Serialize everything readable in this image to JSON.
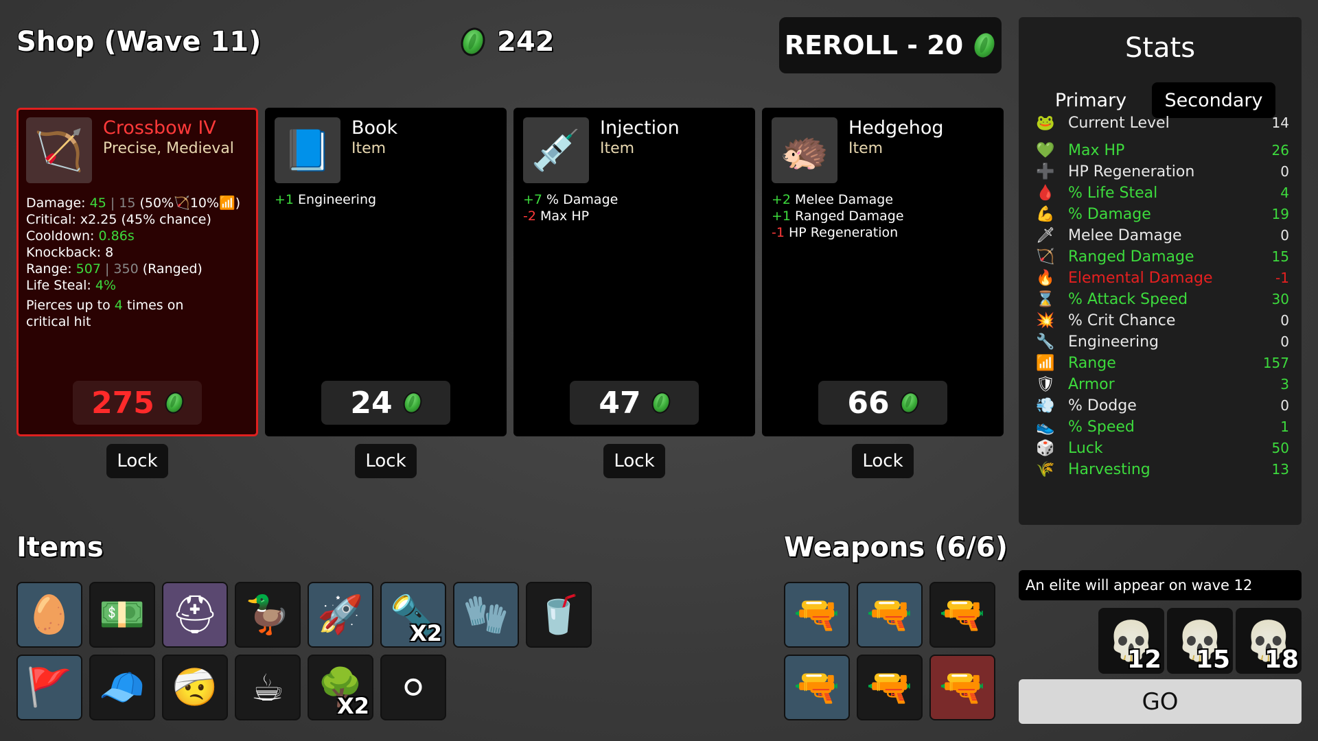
{
  "header": {
    "title": "Shop (Wave 11)",
    "gold": "242",
    "reroll_label": "REROLL - 20"
  },
  "cards": [
    {
      "name": "Crossbow IV",
      "type": "Precise, Medieval",
      "icon": "🏹",
      "price": "275",
      "lock": "Lock",
      "stats": [
        {
          "label": "Damage: ",
          "v1": "45",
          "sep": " | ",
          "v2": "15",
          "rest": " (50%🏹10%📶)"
        },
        {
          "label": "Critical: ",
          "v1": "",
          "sep": "",
          "v2": "",
          "rest": "x2.25 (45% chance)"
        },
        {
          "label": "Cooldown: ",
          "v1": "0.86s",
          "sep": "",
          "v2": "",
          "rest": ""
        },
        {
          "label": "Knockback: ",
          "v1": "",
          "sep": "",
          "v2": "",
          "rest": "8"
        },
        {
          "label": "Range: ",
          "v1": "507",
          "sep": " | ",
          "v2": "350",
          "rest": " (Ranged)"
        },
        {
          "label": "Life Steal: ",
          "v1": "4%",
          "sep": "",
          "v2": "",
          "rest": ""
        }
      ],
      "note_pre": "Pierces up to ",
      "note_num": "4",
      "note_post": " times on critical hit"
    },
    {
      "name": "Book",
      "type": "Item",
      "icon": "📘",
      "price": "24",
      "lock": "Lock",
      "effects": [
        {
          "sign": "+1",
          "text": " Engineering",
          "color": "g"
        }
      ]
    },
    {
      "name": "Injection",
      "type": "Item",
      "icon": "💉",
      "price": "47",
      "lock": "Lock",
      "effects": [
        {
          "sign": "+7",
          "text": " % Damage",
          "color": "g"
        },
        {
          "sign": "-2",
          "text": " Max HP",
          "color": "r"
        }
      ]
    },
    {
      "name": "Hedgehog",
      "type": "Item",
      "icon": "🦔",
      "price": "66",
      "lock": "Lock",
      "effects": [
        {
          "sign": "+2",
          "text": " Melee Damage",
          "color": "g"
        },
        {
          "sign": "+1",
          "text": " Ranged Damage",
          "color": "g"
        },
        {
          "sign": "-1",
          "text": " HP Regeneration",
          "color": "r"
        }
      ]
    }
  ],
  "items_title": "Items",
  "items": [
    {
      "icon": "🥚",
      "tier": "blue",
      "count": ""
    },
    {
      "icon": "💵",
      "tier": "black",
      "count": ""
    },
    {
      "icon": "⛑",
      "tier": "purple",
      "count": ""
    },
    {
      "icon": "🦆",
      "tier": "black",
      "count": ""
    },
    {
      "icon": "🚀",
      "tier": "blue",
      "count": ""
    },
    {
      "icon": "🔦",
      "tier": "blue",
      "count": "X2"
    },
    {
      "icon": "🧤",
      "tier": "blue",
      "count": ""
    },
    {
      "icon": "🥤",
      "tier": "black",
      "count": ""
    },
    {
      "icon": "🚩",
      "tier": "blue",
      "count": ""
    },
    {
      "icon": "🧢",
      "tier": "black",
      "count": ""
    },
    {
      "icon": "🤕",
      "tier": "black",
      "count": ""
    },
    {
      "icon": "☕",
      "tier": "black",
      "count": ""
    },
    {
      "icon": "🌳",
      "tier": "black",
      "count": "X2"
    },
    {
      "icon": "⚪",
      "tier": "black",
      "count": ""
    }
  ],
  "weapons_title": "Weapons (6/6)",
  "weapons": [
    {
      "icon": "🔫",
      "tier": "blue"
    },
    {
      "icon": "🔫",
      "tier": "blue"
    },
    {
      "icon": "🔫",
      "tier": "black"
    },
    {
      "icon": "🔫",
      "tier": "blue"
    },
    {
      "icon": "🔫",
      "tier": "black"
    },
    {
      "icon": "🔫",
      "tier": "red"
    }
  ],
  "stats": {
    "title": "Stats",
    "tab_primary": "Primary",
    "tab_secondary": "Secondary",
    "rows": [
      {
        "icon": "🐸",
        "label": "Current Level",
        "value": "14",
        "color": "w",
        "iname": "level-icon"
      },
      {
        "icon": "💚",
        "label": "Max HP",
        "value": "26",
        "color": "g",
        "iname": "heart-icon"
      },
      {
        "icon": "➕",
        "label": "HP Regeneration",
        "value": "0",
        "color": "w",
        "iname": "regen-icon"
      },
      {
        "icon": "🩸",
        "label": "% Life Steal",
        "value": "4",
        "color": "g",
        "iname": "life-steal-icon"
      },
      {
        "icon": "💪",
        "label": "% Damage",
        "value": "19",
        "color": "g",
        "iname": "damage-icon"
      },
      {
        "icon": "🗡",
        "label": "Melee Damage",
        "value": "0",
        "color": "w",
        "iname": "sword-icon"
      },
      {
        "icon": "🏹",
        "label": "Ranged Damage",
        "value": "15",
        "color": "g",
        "iname": "bow-icon"
      },
      {
        "icon": "🔥",
        "label": "Elemental Damage",
        "value": "-1",
        "color": "r",
        "iname": "flame-icon"
      },
      {
        "icon": "⌛",
        "label": "% Attack Speed",
        "value": "30",
        "color": "g",
        "iname": "hourglass-icon"
      },
      {
        "icon": "💥",
        "label": "% Crit Chance",
        "value": "0",
        "color": "w",
        "iname": "crit-icon"
      },
      {
        "icon": "🔧",
        "label": "Engineering",
        "value": "0",
        "color": "w",
        "iname": "wrench-icon"
      },
      {
        "icon": "📶",
        "label": "Range",
        "value": "157",
        "color": "g",
        "iname": "range-icon"
      },
      {
        "icon": "🛡",
        "label": "Armor",
        "value": "3",
        "color": "g",
        "iname": "shield-icon"
      },
      {
        "icon": "💨",
        "label": "% Dodge",
        "value": "0",
        "color": "w",
        "iname": "dodge-icon"
      },
      {
        "icon": "👟",
        "label": "% Speed",
        "value": "1",
        "color": "g",
        "iname": "boot-icon"
      },
      {
        "icon": "🎲",
        "label": "Luck",
        "value": "50",
        "color": "g",
        "iname": "dice-icon"
      },
      {
        "icon": "🌾",
        "label": "Harvesting",
        "value": "13",
        "color": "g",
        "iname": "wheat-icon"
      }
    ]
  },
  "elite_text": "An elite will appear on wave 12",
  "elite_waves": [
    "12",
    "15",
    "18"
  ],
  "go_label": "GO"
}
